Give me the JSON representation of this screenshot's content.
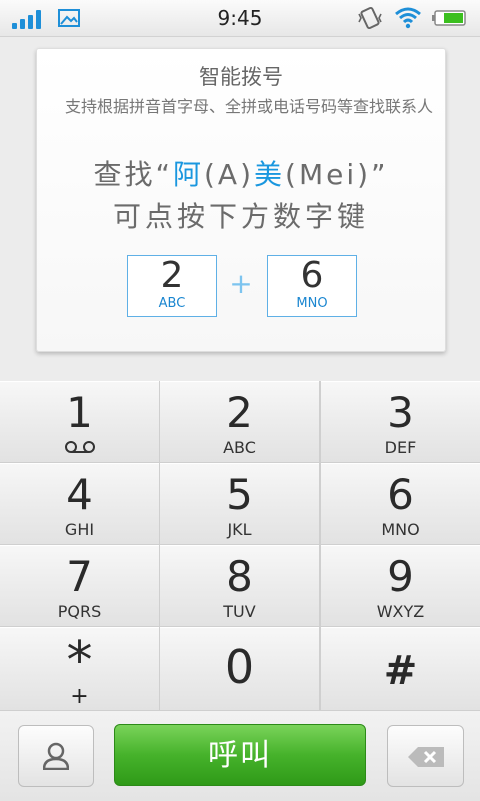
{
  "status_bar": {
    "time": "9:45"
  },
  "hint_card": {
    "title": "智能拨号",
    "description": "支持根据拼音首字母、全拼或电话号码等查找联系人",
    "find_prefix": "查找“",
    "find_char1": "阿",
    "find_char1_pinyin": "(A)",
    "find_char2": "美",
    "find_char2_pinyin": "(Mei)",
    "find_suffix": "”",
    "instruction": "可点按下方数字键",
    "key1_digit": "2",
    "key1_letters": "ABC",
    "plus": "+",
    "key2_digit": "6",
    "key2_letters": "MNO"
  },
  "keypad": {
    "keys": [
      {
        "digit": "1",
        "letters": ""
      },
      {
        "digit": "2",
        "letters": "ABC"
      },
      {
        "digit": "3",
        "letters": "DEF"
      },
      {
        "digit": "4",
        "letters": "GHI"
      },
      {
        "digit": "5",
        "letters": "JKL"
      },
      {
        "digit": "6",
        "letters": "MNO"
      },
      {
        "digit": "7",
        "letters": "PQRS"
      },
      {
        "digit": "8",
        "letters": "TUV"
      },
      {
        "digit": "9",
        "letters": "WXYZ"
      },
      {
        "digit": "*",
        "letters": "+"
      },
      {
        "digit": "0",
        "letters": ""
      },
      {
        "digit": "#",
        "letters": ""
      }
    ]
  },
  "bottom_bar": {
    "call_label": "呼叫"
  },
  "icons": {
    "signal": "signal-icon",
    "gallery": "gallery-icon",
    "vibrate": "vibrate-icon",
    "wifi": "wifi-icon",
    "battery": "battery-icon",
    "voicemail": "voicemail-icon",
    "contacts": "contacts-icon",
    "delete": "backspace-icon"
  },
  "colors": {
    "accent": "#1a97df",
    "call_green": "#46b22b",
    "battery_green": "#3bbf1f"
  }
}
